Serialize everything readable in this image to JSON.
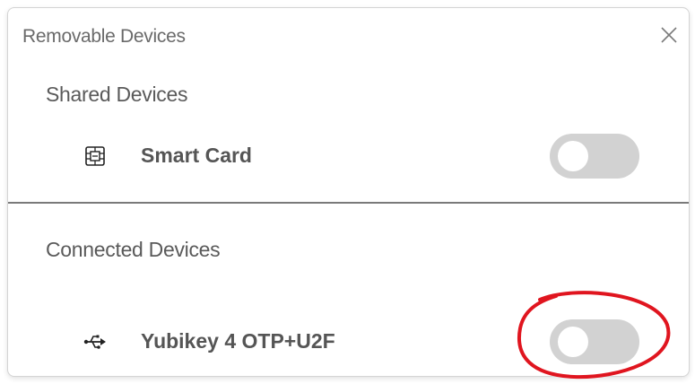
{
  "dialog": {
    "title": "Removable Devices"
  },
  "shared": {
    "section_label": "Shared Devices",
    "devices": [
      {
        "name": "Smart Card",
        "icon": "smart-card-icon",
        "enabled": false
      }
    ]
  },
  "connected": {
    "section_label": "Connected Devices",
    "devices": [
      {
        "name": "Yubikey 4 OTP+U2F",
        "icon": "usb-icon",
        "enabled": false
      }
    ]
  },
  "colors": {
    "toggle_off": "#d2d2d2",
    "annotation": "#e0151f",
    "divider": "#7a7a7a"
  }
}
